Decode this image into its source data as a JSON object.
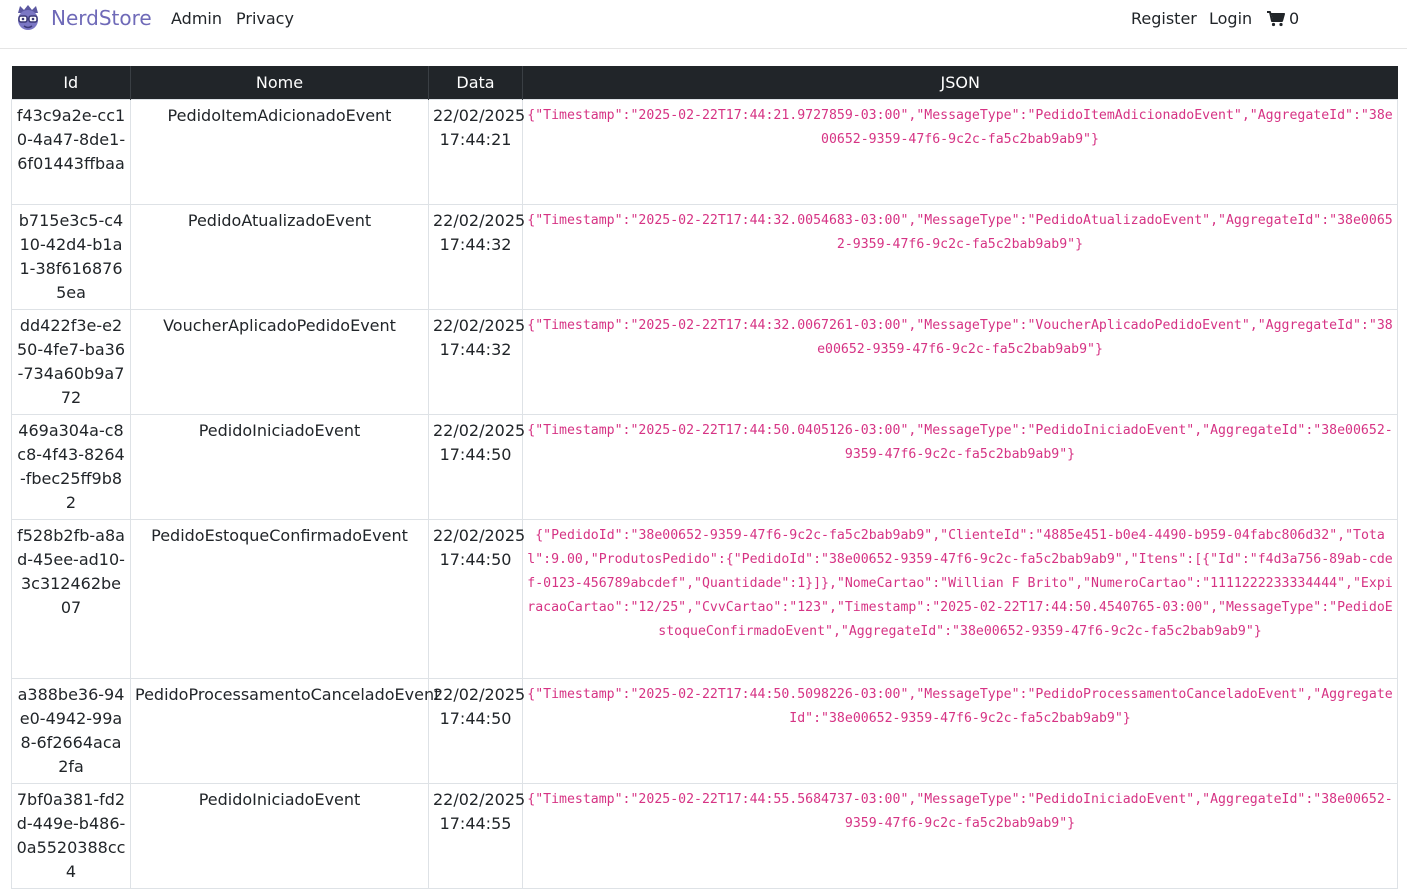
{
  "navbar": {
    "brand": "NerdStore",
    "links": [
      "Admin",
      "Privacy"
    ],
    "register": "Register",
    "login": "Login",
    "cart_count": "0"
  },
  "table": {
    "headers": [
      "Id",
      "Nome",
      "Data",
      "JSON"
    ],
    "rows": [
      {
        "id": "f43c9a2e-cc10-4a47-8de1-6f01443ffbaa",
        "nome": "PedidoItemAdicionadoEvent",
        "data": "22/02/2025 17:44:21",
        "json": "{\"Timestamp\":\"2025-02-22T17:44:21.9727859-03:00\",\"MessageType\":\"PedidoItemAdicionadoEvent\",\"AggregateId\":\"38e00652-9359-47f6-9c2c-fa5c2bab9ab9\"}"
      },
      {
        "id": "b715e3c5-c410-42d4-b1a1-38f6168765ea",
        "nome": "PedidoAtualizadoEvent",
        "data": "22/02/2025 17:44:32",
        "json": "{\"Timestamp\":\"2025-02-22T17:44:32.0054683-03:00\",\"MessageType\":\"PedidoAtualizadoEvent\",\"AggregateId\":\"38e00652-9359-47f6-9c2c-fa5c2bab9ab9\"}"
      },
      {
        "id": "dd422f3e-e250-4fe7-ba36-734a60b9a772",
        "nome": "VoucherAplicadoPedidoEvent",
        "data": "22/02/2025 17:44:32",
        "json": "{\"Timestamp\":\"2025-02-22T17:44:32.0067261-03:00\",\"MessageType\":\"VoucherAplicadoPedidoEvent\",\"AggregateId\":\"38e00652-9359-47f6-9c2c-fa5c2bab9ab9\"}"
      },
      {
        "id": "469a304a-c8c8-4f43-8264-fbec25ff9b82",
        "nome": "PedidoIniciadoEvent",
        "data": "22/02/2025 17:44:50",
        "json": "{\"Timestamp\":\"2025-02-22T17:44:50.0405126-03:00\",\"MessageType\":\"PedidoIniciadoEvent\",\"AggregateId\":\"38e00652-9359-47f6-9c2c-fa5c2bab9ab9\"}"
      },
      {
        "id": "f528b2fb-a8ad-45ee-ad10-3c312462be07",
        "nome": "PedidoEstoqueConfirmadoEvent",
        "data": "22/02/2025 17:44:50",
        "json": "{\"PedidoId\":\"38e00652-9359-47f6-9c2c-fa5c2bab9ab9\",\"ClienteId\":\"4885e451-b0e4-4490-b959-04fabc806d32\",\"Total\":9.00,\"ProdutosPedido\":{\"PedidoId\":\"38e00652-9359-47f6-9c2c-fa5c2bab9ab9\",\"Itens\":[{\"Id\":\"f4d3a756-89ab-cdef-0123-456789abcdef\",\"Quantidade\":1}]},\"NomeCartao\":\"Willian F Brito\",\"NumeroCartao\":\"1111222233334444\",\"ExpiracaoCartao\":\"12/25\",\"CvvCartao\":\"123\",\"Timestamp\":\"2025-02-22T17:44:50.4540765-03:00\",\"MessageType\":\"PedidoEstoqueConfirmadoEvent\",\"AggregateId\":\"38e00652-9359-47f6-9c2c-fa5c2bab9ab9\"}"
      },
      {
        "id": "a388be36-94e0-4942-99a8-6f2664aca2fa",
        "nome": "PedidoProcessamentoCanceladoEvent",
        "data": "22/02/2025 17:44:50",
        "json": "{\"Timestamp\":\"2025-02-22T17:44:50.5098226-03:00\",\"MessageType\":\"PedidoProcessamentoCanceladoEvent\",\"AggregateId\":\"38e00652-9359-47f6-9c2c-fa5c2bab9ab9\"}"
      },
      {
        "id": "7bf0a381-fd2d-449e-b486-0a5520388cc4",
        "nome": "PedidoIniciadoEvent",
        "data": "22/02/2025 17:44:55",
        "json": "{\"Timestamp\":\"2025-02-22T17:44:55.5684737-03:00\",\"MessageType\":\"PedidoIniciadoEvent\",\"AggregateId\":\"38e00652-9359-47f6-9c2c-fa5c2bab9ab9\"}"
      }
    ]
  }
}
